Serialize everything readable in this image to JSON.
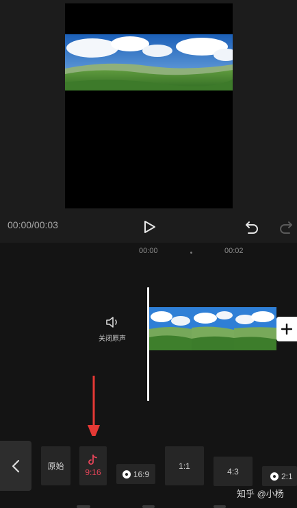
{
  "player": {
    "time": "00:00/00:03",
    "icons": {
      "play": "play-icon",
      "undo": "undo-icon",
      "redo": "redo-icon"
    }
  },
  "timeline": {
    "ruler": [
      "00:00",
      "00:02"
    ],
    "mute_label": "关闭原声",
    "icons": {
      "mute": "speaker-icon",
      "add": "plus-icon"
    }
  },
  "toolbar": {
    "back_icon": "chevron-left-icon",
    "ratios": [
      {
        "label": "原始"
      },
      {
        "label": "9:16",
        "icon": "tiktok-icon",
        "selected": true
      },
      {
        "label": "16:9",
        "icon": "platform-badge-icon"
      },
      {
        "label": "1:1"
      },
      {
        "label": "4:3"
      },
      {
        "label": "2:1",
        "icon": "platform-badge-icon"
      }
    ]
  },
  "watermark": "知乎 @小杨",
  "colors": {
    "accent": "#e8455a",
    "arrow": "#e53935",
    "background": "#151515"
  }
}
